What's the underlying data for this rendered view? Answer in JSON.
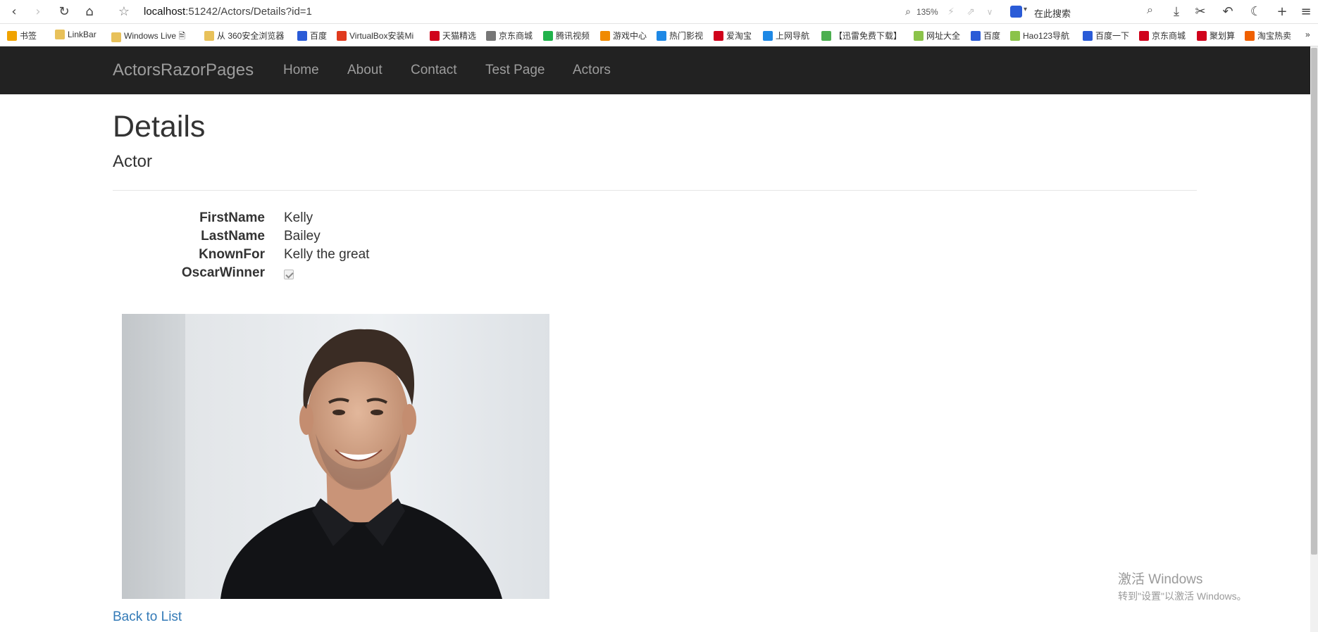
{
  "browser": {
    "url_host": "localhost",
    "url_path": ":51242/Actors/Details?id=1",
    "zoom": "135%",
    "search_placeholder": "在此搜索",
    "icons": [
      "back-icon",
      "forward-icon",
      "reload-icon",
      "home-icon",
      "star-icon",
      "zoom-icon",
      "lightning-icon",
      "share-icon",
      "chevron-down-icon",
      "search-icon",
      "download-icon",
      "scissors-icon",
      "undo-icon",
      "moon-icon",
      "plus-icon",
      "menu-icon"
    ]
  },
  "bookmarks": [
    {
      "label": "书签",
      "color": "#f0a300"
    },
    {
      "label": "LinkBar",
      "color": "#e8c15a"
    },
    {
      "label": "Windows Live 🗎",
      "color": "#e8c15a"
    },
    {
      "label": "从 360安全浏览器",
      "color": "#e8c15a"
    },
    {
      "label": "百度",
      "color": "#2a5bd7"
    },
    {
      "label": "VirtualBox安装Mi",
      "color": "#e03a1e"
    },
    {
      "label": "天猫精选",
      "color": "#d0021b"
    },
    {
      "label": "京东商城",
      "color": "#777777"
    },
    {
      "label": "腾讯视频",
      "color": "#21b24b"
    },
    {
      "label": "游戏中心",
      "color": "#f08a00"
    },
    {
      "label": "热门影视",
      "color": "#1e88e5"
    },
    {
      "label": "爱淘宝",
      "color": "#d0021b"
    },
    {
      "label": "上网导航",
      "color": "#1e88e5"
    },
    {
      "label": "【迅雷免费下载】",
      "color": "#4caf50"
    },
    {
      "label": "网址大全",
      "color": "#8bc34a"
    },
    {
      "label": "百度",
      "color": "#2a5bd7"
    },
    {
      "label": "Hao123导航",
      "color": "#8bc34a"
    },
    {
      "label": "百度一下",
      "color": "#2a5bd7"
    },
    {
      "label": "京东商城",
      "color": "#d0021b"
    },
    {
      "label": "聚划算",
      "color": "#d0021b"
    },
    {
      "label": "淘宝热卖",
      "color": "#f06000"
    }
  ],
  "navbar": {
    "brand": "ActorsRazorPages",
    "links": [
      "Home",
      "About",
      "Contact",
      "Test Page",
      "Actors"
    ]
  },
  "page": {
    "title": "Details",
    "subtitle": "Actor",
    "fields": [
      {
        "label": "FirstName",
        "value": "Kelly"
      },
      {
        "label": "LastName",
        "value": "Bailey"
      },
      {
        "label": "KnownFor",
        "value": "Kelly the great"
      },
      {
        "label": "OscarWinner",
        "value": ""
      }
    ],
    "oscar_winner_checked": true,
    "back_link": "Back to List"
  },
  "watermark": {
    "title": "激活 Windows",
    "subtitle": "转到\"设置\"以激活 Windows。"
  },
  "colors": {
    "navbar_bg": "#222222",
    "nav_text": "#9d9d9d",
    "link": "#337ab7"
  }
}
